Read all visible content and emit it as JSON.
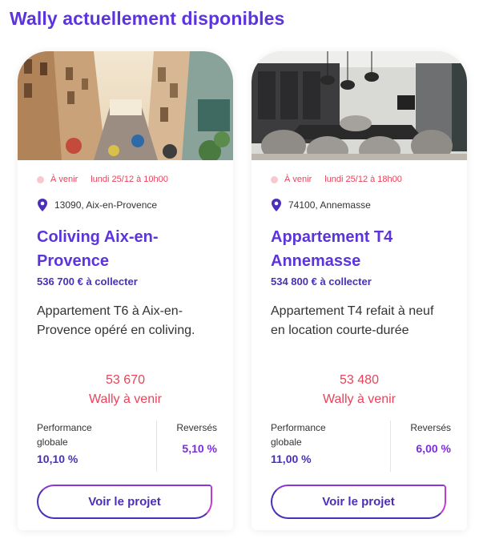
{
  "page": {
    "title": "Wally actuellement disponibles"
  },
  "cards": [
    {
      "status": "À venir",
      "date": "lundi 25/12 à 10h00",
      "location": "13090, Aix-en-Provence",
      "title": "Coliving Aix-en-Provence",
      "collect": "536 700 € à collecter",
      "description": "Appartement T6 à Aix-en-Provence opéré en coliving.",
      "wally_count": "53 670",
      "wally_label": "Wally à venir",
      "perf_label": "Performance globale",
      "perf_value": "10,10 %",
      "reverses_label": "Reversés",
      "reverses_value": "5,10 %",
      "cta": "Voir le projet",
      "image": "street-photo"
    },
    {
      "status": "À venir",
      "date": "lundi 25/12 à 18h00",
      "location": "74100, Annemasse",
      "title": "Appartement T4 Annemasse",
      "collect": "534 800 € à collecter",
      "description": "Appartement T4 refait à neuf en location courte-durée",
      "wally_count": "53 480",
      "wally_label": "Wally à venir",
      "perf_label": "Performance globale",
      "perf_value": "11,00 %",
      "reverses_label": "Reversés",
      "reverses_value": "6,00 %",
      "cta": "Voir le projet",
      "image": "dining-room-photo"
    }
  ],
  "colors": {
    "brand": "#5b34dd",
    "status": "#e8435a",
    "accent_purple": "#7a2fd6"
  }
}
